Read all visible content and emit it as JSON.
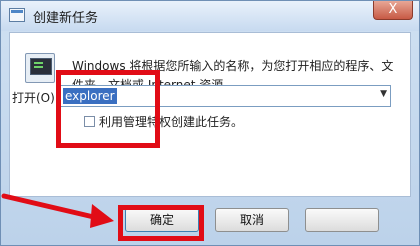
{
  "window": {
    "title": "创建新任务",
    "close_glyph": "X"
  },
  "dialog": {
    "description": "Windows 将根据您所输入的名称，为您打开相应的程序、文件夹、文档或 Internet 资源。",
    "open_label": "打开(O):",
    "input_value": "explorer",
    "admin_checkbox_label": "利用管理特权创建此任务。",
    "admin_checked": false
  },
  "buttons": {
    "ok": "确定",
    "cancel": "取消",
    "browse": ""
  },
  "annotations": {
    "highlight_color": "#e10c16"
  }
}
